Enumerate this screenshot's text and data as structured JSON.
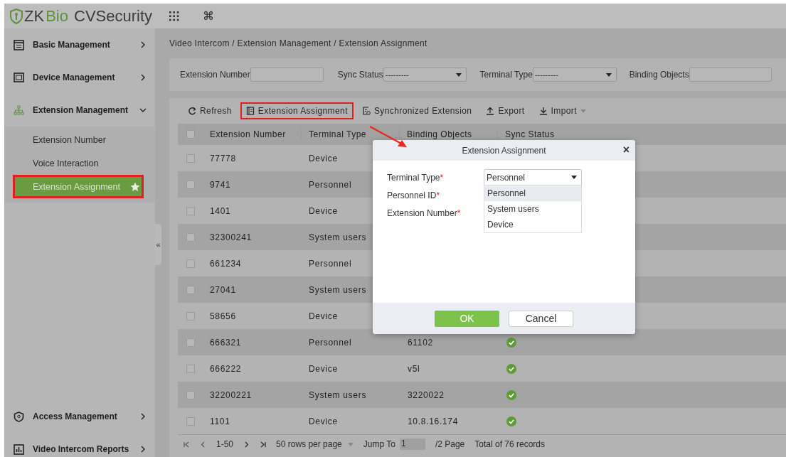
{
  "header": {
    "logo": [
      {
        "text": "ZK",
        "kind": "plain"
      },
      {
        "text": "Bio",
        "kind": "accent"
      },
      {
        "text": " CVSecurity",
        "kind": "plain"
      }
    ],
    "shortcut_symbol": "⌘"
  },
  "sidebar": {
    "items": [
      {
        "label": "Basic Management",
        "expanded": false
      },
      {
        "label": "Device Management",
        "expanded": false
      },
      {
        "label": "Extension Management",
        "expanded": true,
        "children": [
          {
            "label": "Extension Number",
            "selected": false,
            "annotated": false
          },
          {
            "label": "Voice Interaction",
            "selected": false,
            "annotated": false
          },
          {
            "label": "Extension Assignment",
            "selected": true,
            "annotated": true
          }
        ]
      }
    ],
    "bottom_items": [
      {
        "label": "Access Management",
        "expanded": false
      },
      {
        "label": "Video Intercom Reports",
        "expanded": false
      }
    ],
    "collapse_handle": "«"
  },
  "breadcrumb": "Video Intercom / Extension Management / Extension Assignment",
  "filters": [
    {
      "label": "Extension Number",
      "kind": "input"
    },
    {
      "label": "Sync Status",
      "kind": "select",
      "value": "---------"
    },
    {
      "label": "Terminal Type",
      "kind": "select",
      "value": "---------"
    },
    {
      "label": "Binding Objects",
      "kind": "input"
    }
  ],
  "toolbar": [
    {
      "label": "Refresh",
      "kind": "refresh",
      "annotated": false,
      "has_menu": false
    },
    {
      "label": "Extension Assignment",
      "kind": "assign",
      "annotated": true,
      "has_menu": false
    },
    {
      "label": "Synchronized Extension",
      "kind": "sync",
      "annotated": false,
      "has_menu": false
    },
    {
      "label": "Export",
      "kind": "export",
      "annotated": false,
      "has_menu": false
    },
    {
      "label": "Import",
      "kind": "import",
      "annotated": false,
      "has_menu": true
    }
  ],
  "table": {
    "all_checked": false,
    "columns": [
      "Extension Number",
      "Terminal Type",
      "Binding Objects",
      "Sync Status"
    ],
    "rows": [
      {
        "checked": false,
        "extension": "77778",
        "terminal_type": "Device"
      },
      {
        "checked": false,
        "extension": "9741",
        "terminal_type": "Personnel"
      },
      {
        "checked": false,
        "extension": "1401",
        "terminal_type": "Device"
      },
      {
        "checked": false,
        "extension": "32300241",
        "terminal_type": "System users"
      },
      {
        "checked": false,
        "extension": "661234",
        "terminal_type": "Personnel"
      },
      {
        "checked": false,
        "extension": "27041",
        "terminal_type": "System users"
      },
      {
        "checked": false,
        "extension": "58656",
        "terminal_type": "Device"
      },
      {
        "checked": false,
        "extension": "666321",
        "terminal_type": "Personnel",
        "binding": "61102",
        "synced": true
      },
      {
        "checked": false,
        "extension": "666222",
        "terminal_type": "Device",
        "binding": "v5l",
        "synced": true
      },
      {
        "checked": false,
        "extension": "32200221",
        "terminal_type": "System users",
        "binding": "3220022",
        "synced": true
      },
      {
        "checked": false,
        "extension": "1101",
        "terminal_type": "Device",
        "binding": "10.8.16.174",
        "synced": true
      }
    ]
  },
  "pagination": {
    "range": "1-50",
    "page_size": "50 rows per page",
    "jump_label": "Jump To",
    "jump_value": "1",
    "pages": "/2 Page",
    "total": "Total of 76 records"
  },
  "dialog": {
    "title": "Extension Assignment",
    "close": "×",
    "fields": [
      {
        "label": "Terminal Type",
        "required_mark": "*",
        "kind": "select",
        "value": "Personnel",
        "open": true,
        "options": [
          {
            "label": "Personnel",
            "selected": true
          },
          {
            "label": "System users",
            "selected": false
          },
          {
            "label": "Device",
            "selected": false
          }
        ]
      },
      {
        "label": "Personnel ID",
        "required_mark": "*",
        "kind": "input"
      },
      {
        "label": "Extension Number",
        "required_mark": "*",
        "kind": "input"
      }
    ],
    "buttons": [
      {
        "label": "OK",
        "kind": "primary"
      },
      {
        "label": "Cancel",
        "kind": "secondary"
      }
    ]
  }
}
